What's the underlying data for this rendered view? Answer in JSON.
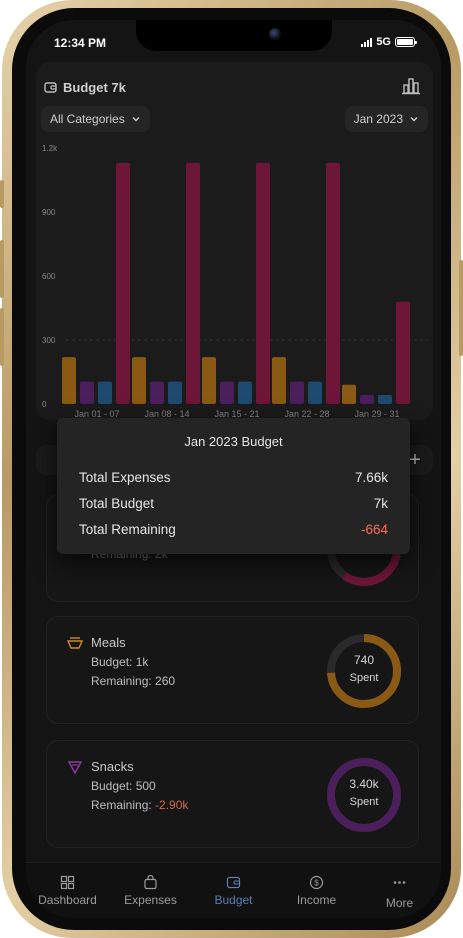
{
  "status_bar": {
    "time": "12:34 PM",
    "network": "5G"
  },
  "budget_card": {
    "title": "Budget 7k",
    "category_filter": "All Categories",
    "month_filter": "Jan 2023"
  },
  "chart_data": {
    "type": "bar",
    "categories": [
      "Jan 01 - 07",
      "Jan 08 - 14",
      "Jan 15 - 21",
      "Jan 22 - 28",
      "Jan 29 - 31"
    ],
    "y_ticks": [
      "1.2k",
      "900",
      "600",
      "300",
      "0"
    ],
    "ylim": [
      0,
      1200
    ],
    "series": [
      {
        "color": "#8a5a14",
        "values": [
          220,
          220,
          220,
          220,
          90
        ]
      },
      {
        "color": "#4a1f5c",
        "values": [
          105,
          105,
          105,
          105,
          42
        ]
      },
      {
        "color": "#1f4a70",
        "values": [
          105,
          105,
          105,
          105,
          42
        ]
      },
      {
        "color": "#6e1638",
        "values": [
          1130,
          1130,
          1130,
          1130,
          480
        ]
      }
    ]
  },
  "tooltip": {
    "title": "Jan 2023 Budget",
    "rows": [
      {
        "label": "Total Expenses",
        "value": "7.66k"
      },
      {
        "label": "Total Budget",
        "value": "7k"
      },
      {
        "label": "Total Remaining",
        "value": "-664"
      }
    ]
  },
  "budget_items": [
    {
      "name": "",
      "budget": "",
      "remaining": "Remaining: 2k",
      "spent_value": "",
      "spent_label": "Spent",
      "color": "#6e1638",
      "spent_fraction": 0.6
    },
    {
      "name": "Meals",
      "budget": "Budget: 1k",
      "remaining_label": "Remaining:",
      "remaining_value": "260",
      "spent_value": "740",
      "spent_label": "Spent",
      "color": "#8a5a14",
      "spent_fraction": 0.74
    },
    {
      "name": "Snacks",
      "budget": "Budget: 500",
      "remaining_label": "Remaining:",
      "remaining_value": "-2.90k",
      "spent_value": "3.40k",
      "spent_label": "Spent",
      "color": "#4a1f5c",
      "spent_fraction": 1.0
    }
  ],
  "tabs": [
    {
      "label": "Dashboard",
      "icon": "dashboard-icon"
    },
    {
      "label": "Expenses",
      "icon": "bag-icon"
    },
    {
      "label": "Budget",
      "icon": "wallet-icon",
      "active": true
    },
    {
      "label": "Income",
      "icon": "dollar-icon"
    },
    {
      "label": "More",
      "icon": "more-icon"
    }
  ],
  "colors": {
    "accent": "#5b7fb0",
    "negative": "#ff6b5b"
  }
}
